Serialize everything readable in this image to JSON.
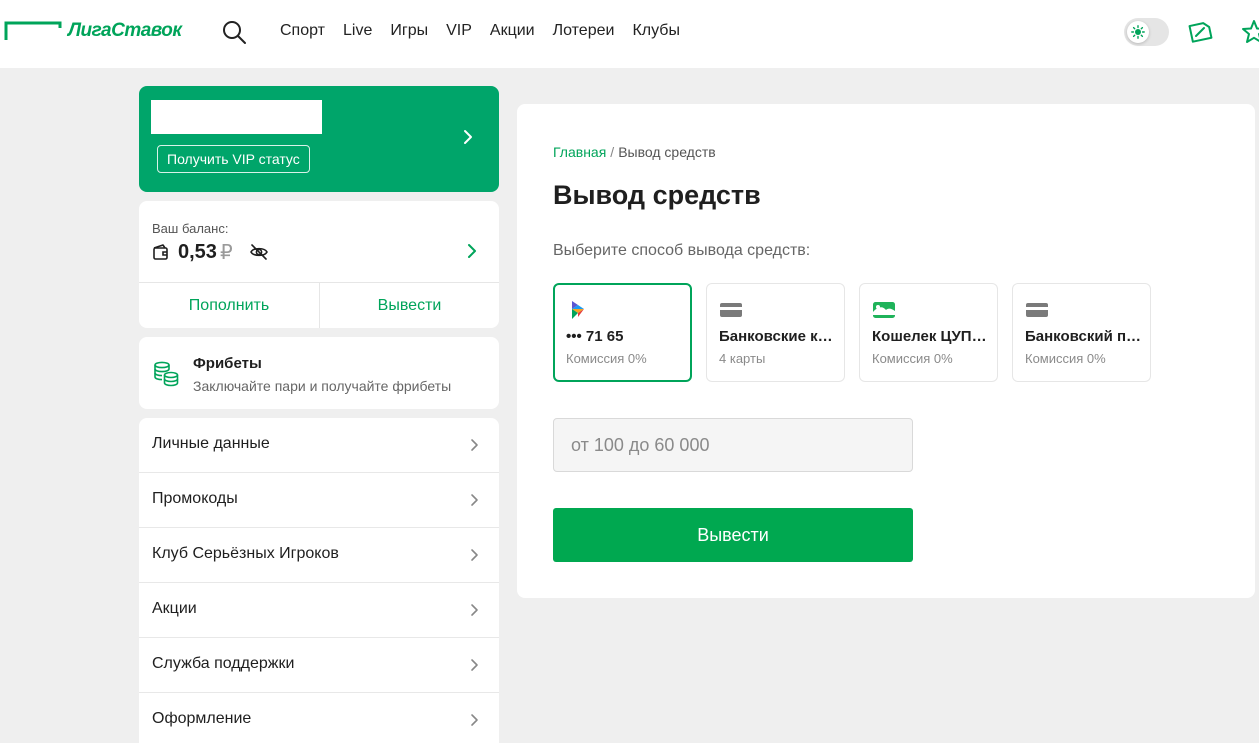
{
  "header": {
    "logo_text": "ЛигаСтавок",
    "nav": [
      "Спорт",
      "Live",
      "Игры",
      "VIP",
      "Акции",
      "Лотереи",
      "Клубы"
    ]
  },
  "vip": {
    "button_label": "Получить VIP статус"
  },
  "balance": {
    "label": "Ваш баланс:",
    "value": "0,53",
    "currency": "₽",
    "deposit_label": "Пополнить",
    "withdraw_label": "Вывести"
  },
  "freebets": {
    "title": "Фрибеты",
    "subtitle": "Заключайте пари и получайте фрибеты"
  },
  "menu": [
    {
      "label": "Личные данные"
    },
    {
      "label": "Промокоды"
    },
    {
      "label": "Клуб Серьёзных Игроков"
    },
    {
      "label": "Акции"
    },
    {
      "label": "Служба поддержки"
    },
    {
      "label": "Оформление"
    }
  ],
  "main": {
    "breadcrumb_home": "Главная",
    "breadcrumb_sep": "/",
    "breadcrumb_current": "Вывод средств",
    "title": "Вывод средств",
    "prompt": "Выберите способ вывода средств:",
    "methods": [
      {
        "title": "••• 71 65",
        "subtitle": "Комиссия 0%",
        "icon": "sbp-icon",
        "selected": true
      },
      {
        "title": "Банковские карты",
        "subtitle": "4 карты",
        "icon": "card-icon",
        "selected": false
      },
      {
        "title": "Кошелек ЦУПИС",
        "subtitle": "Комиссия 0%",
        "icon": "wallet-cupis-icon",
        "selected": false
      },
      {
        "title": "Банковский перевод",
        "subtitle": "Комиссия 0%",
        "icon": "card-icon",
        "selected": false
      }
    ],
    "amount_placeholder": "от 100 до 60 000",
    "submit_label": "Вывести"
  },
  "colors": {
    "brand_green": "#00a45a",
    "vip_green": "#00a56a",
    "button_green": "#00a850",
    "background": "#efefef"
  }
}
